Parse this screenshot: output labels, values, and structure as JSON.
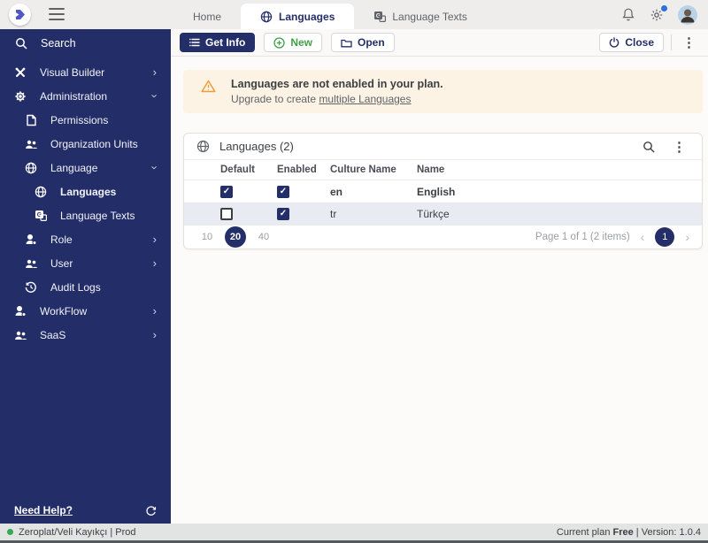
{
  "colors": {
    "navy": "#242e68",
    "green": "#43a047",
    "banner_bg": "#fdf3e4",
    "warning_orange": "#f29c38",
    "alt_row": "#e9ebf2",
    "status_green": "#34a853",
    "notification_blue": "#2d6fdb"
  },
  "header": {
    "tabs": [
      {
        "label": "Home",
        "icon": null,
        "active": false
      },
      {
        "label": "Languages",
        "icon": "globe-icon",
        "active": true
      },
      {
        "label": "Language Texts",
        "icon": "translate-icon",
        "active": false
      }
    ],
    "icons": [
      "bell-icon",
      "gear-icon",
      "avatar"
    ]
  },
  "sidebar": {
    "search_label": "Search",
    "items": [
      {
        "label": "Visual Builder",
        "icon": "tools-icon",
        "level": 0,
        "chevron": "right"
      },
      {
        "label": "Administration",
        "icon": "gear-icon",
        "level": 0,
        "chevron": "down"
      },
      {
        "label": "Permissions",
        "icon": "document-icon",
        "level": 1
      },
      {
        "label": "Organization Units",
        "icon": "people-icon",
        "level": 1
      },
      {
        "label": "Language",
        "icon": "globe-icon",
        "level": 1,
        "chevron": "down"
      },
      {
        "label": "Languages",
        "icon": "globe-icon",
        "level": 2,
        "active": true
      },
      {
        "label": "Language Texts",
        "icon": "translate-icon",
        "level": 2
      },
      {
        "label": "Role",
        "icon": "role-icon",
        "level": 1,
        "chevron": "right"
      },
      {
        "label": "User",
        "icon": "people-icon",
        "level": 1,
        "chevron": "right"
      },
      {
        "label": "Audit Logs",
        "icon": "history-icon",
        "level": 1
      },
      {
        "label": "WorkFlow",
        "icon": "workflow-icon",
        "level": 0,
        "chevron": "right"
      },
      {
        "label": "SaaS",
        "icon": "people-icon",
        "level": 0,
        "chevron": "right"
      }
    ],
    "help_label": "Need Help?"
  },
  "toolbar": {
    "get_info_label": "Get Info",
    "new_label": "New",
    "open_label": "Open",
    "close_label": "Close"
  },
  "banner": {
    "title": "Languages are not enabled in your plan.",
    "body_prefix": "Upgrade to create ",
    "link_label": "multiple Languages"
  },
  "card": {
    "title": "Languages (2)",
    "columns": [
      "Default",
      "Enabled",
      "Culture Name",
      "Name"
    ],
    "rows": [
      {
        "default": true,
        "enabled": true,
        "culture": "en",
        "name": "English",
        "bold": true
      },
      {
        "default": false,
        "enabled": true,
        "culture": "tr",
        "name": "Türkçe",
        "bold": false
      }
    ],
    "page_sizes": [
      "10",
      "20",
      "40"
    ],
    "active_page_size": "20",
    "page_info": "Page 1 of 1 (2 items)",
    "current_page": "1",
    "prev_chevron": "‹",
    "next_chevron": "›"
  },
  "statusbar": {
    "left": "Zeroplat/Veli Kayıkçı | Prod",
    "right_prefix": "Current plan ",
    "right_bold": "Free",
    "right_suffix": " | Version: 1.0.4"
  }
}
